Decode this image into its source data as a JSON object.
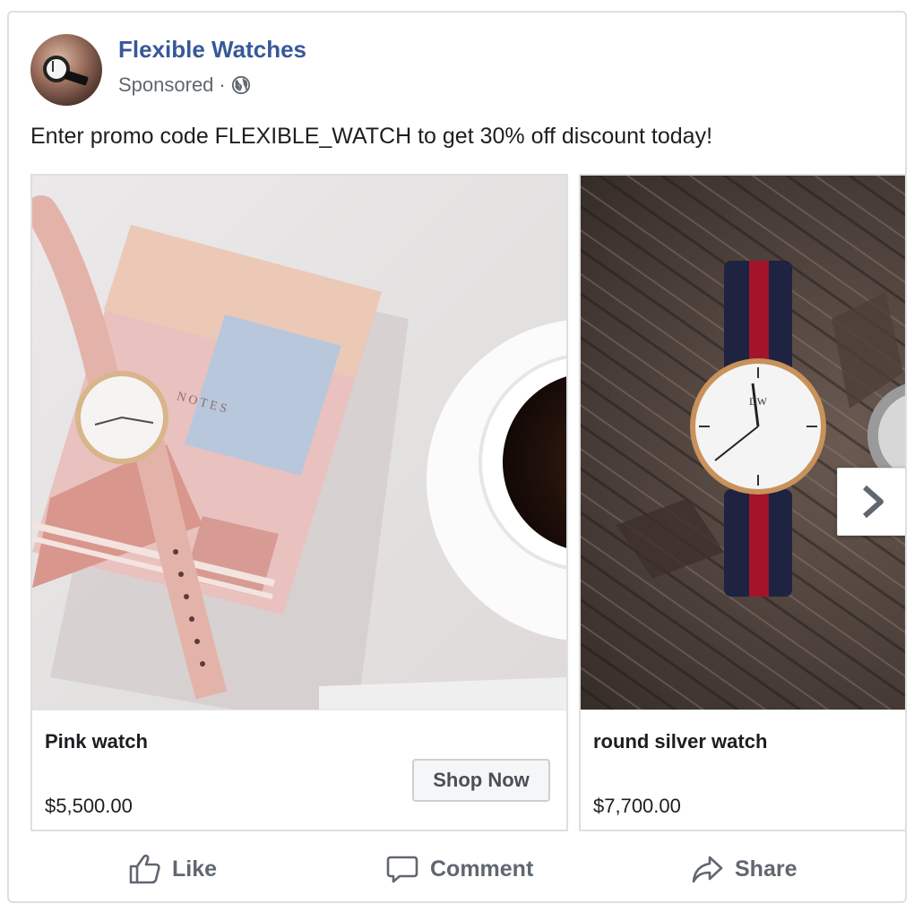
{
  "post": {
    "page_name": "Flexible Watches",
    "sponsored_label": "Sponsored",
    "separator": "·",
    "audience_icon": "globe-icon",
    "text": "Enter promo code FLEXIBLE_WATCH to get 30% off discount today!"
  },
  "carousel": {
    "items": [
      {
        "title": "Pink watch",
        "price": "$5,500.00",
        "cta": "Shop Now"
      },
      {
        "title": "round silver watch",
        "price": "$7,700.00"
      }
    ],
    "next_icon": "chevron-right-icon"
  },
  "actions": {
    "like": "Like",
    "comment": "Comment",
    "share": "Share"
  },
  "colors": {
    "page_name": "#385898",
    "secondary_text": "#616770",
    "action_text": "#606770",
    "border": "#dddfe2"
  }
}
